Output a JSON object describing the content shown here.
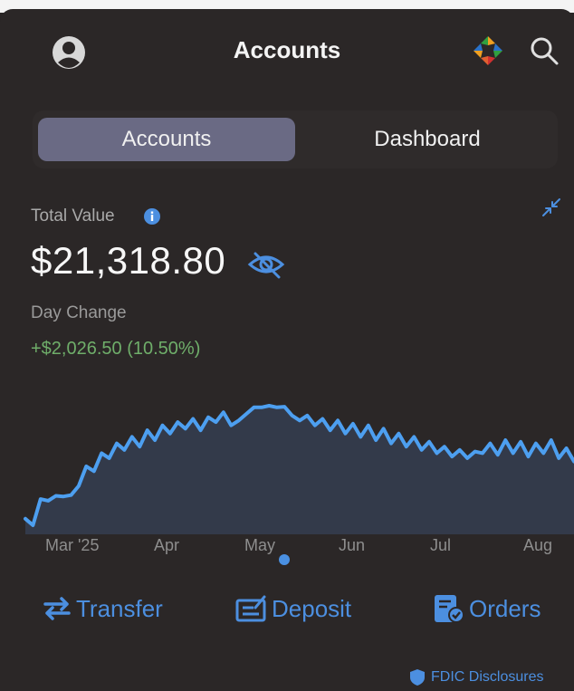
{
  "header": {
    "title": "Accounts",
    "avatar_icon": "person-icon",
    "logo_icon": "app-logo",
    "search_icon": "search-icon"
  },
  "tabs": [
    {
      "label": "Accounts",
      "active": true
    },
    {
      "label": "Dashboard",
      "active": false
    }
  ],
  "summary": {
    "total_label": "Total Value",
    "total_value": "$21,318.80",
    "day_change_label": "Day Change",
    "day_change_value": "+$2,026.50 (10.50%)"
  },
  "chart_data": {
    "type": "area",
    "x_labels": [
      "Mar '25",
      "Apr",
      "May",
      "Jun",
      "Jul",
      "Aug"
    ],
    "values": [
      1890,
      1870,
      1950,
      1945,
      1960,
      1958,
      1962,
      1990,
      2050,
      2035,
      2090,
      2075,
      2120,
      2100,
      2140,
      2110,
      2160,
      2130,
      2175,
      2150,
      2185,
      2165,
      2195,
      2160,
      2200,
      2185,
      2215,
      2175,
      2190,
      2210,
      2230,
      2230,
      2235,
      2230,
      2232,
      2205,
      2190,
      2205,
      2175,
      2195,
      2160,
      2190,
      2150,
      2180,
      2140,
      2175,
      2130,
      2165,
      2120,
      2150,
      2110,
      2140,
      2100,
      2125,
      2090,
      2110,
      2080,
      2100,
      2075,
      2095,
      2090,
      2120,
      2085,
      2130,
      2090,
      2125,
      2080,
      2120,
      2090,
      2130,
      2075,
      2105,
      2065
    ],
    "colors": {
      "line": "#4d9ff0",
      "fill": "#333a4a"
    }
  },
  "actions": [
    {
      "label": "Transfer",
      "icon": "transfer-icon"
    },
    {
      "label": "Deposit",
      "icon": "deposit-icon"
    },
    {
      "label": "Orders",
      "icon": "orders-icon"
    }
  ],
  "footer": {
    "fdic_label": "FDIC Disclosures",
    "fdic_icon": "shield-icon"
  }
}
